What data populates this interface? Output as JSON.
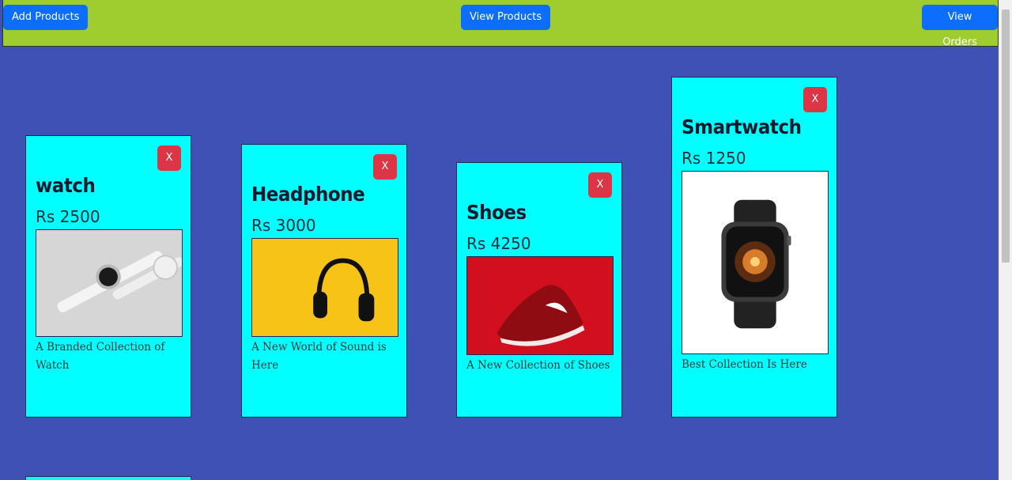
{
  "nav": {
    "add_products": "Add Products",
    "view_products": "View Products",
    "view_orders": "View Orders"
  },
  "products": [
    {
      "title": "watch",
      "price": "Rs 2500",
      "description": "A Branded Collection of Watch",
      "remove_label": "X",
      "image_icon": "watch-image"
    },
    {
      "title": "Headphone",
      "price": "Rs 3000",
      "description": "A New World of Sound is Here",
      "remove_label": "X",
      "image_icon": "headphone-image"
    },
    {
      "title": "Shoes",
      "price": "Rs 4250",
      "description": "A New Collection of Shoes",
      "remove_label": "X",
      "image_icon": "shoe-image"
    },
    {
      "title": "Smartwatch",
      "price": "Rs 1250",
      "description": "Best Collection Is Here",
      "remove_label": "X",
      "image_icon": "smartwatch-image"
    }
  ],
  "colors": {
    "background": "#3f51b5",
    "topbar": "#9fcd2f",
    "card": "#00ffff",
    "primary_button": "#0d6efd",
    "danger_button": "#dc3545"
  }
}
